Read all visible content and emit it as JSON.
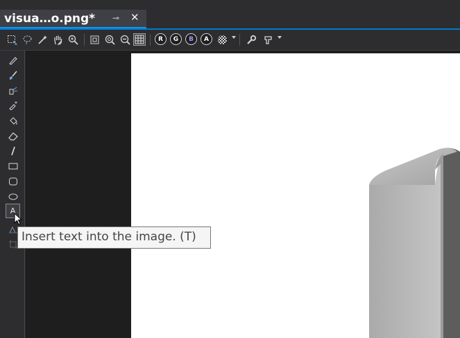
{
  "tab": {
    "title": "visua…o.png*",
    "pin_glyph": "⊸",
    "close_glyph": "✕"
  },
  "toolbar": {
    "icons": [
      "select-rectangle-icon",
      "lasso-select-icon",
      "magic-wand-icon",
      "pan-hand-icon",
      "zoom-icon",
      "actual-size-icon",
      "zoom-in-icon",
      "zoom-out-icon",
      "grid-icon",
      "channel-r",
      "channel-g",
      "channel-b",
      "channel-a",
      "transparency-checker-icon",
      "properties-wrench-icon",
      "image-format-icon"
    ],
    "channels": {
      "r": "R",
      "g": "G",
      "b": "B",
      "a": "A"
    }
  },
  "palette": {
    "tools": [
      "pencil-icon",
      "brush-icon",
      "airbrush-icon",
      "eyedropper-icon",
      "fill-icon",
      "eraser-icon",
      "line-icon",
      "rectangle-icon",
      "rounded-rectangle-icon",
      "ellipse-icon",
      "text-icon"
    ],
    "text_tool_glyph": "A"
  },
  "tooltip": {
    "text": "Insert text into the image. (T)"
  },
  "colors": {
    "accent": "#007acc",
    "background": "#252526",
    "tooltip_bg": "#f5f5f5"
  }
}
